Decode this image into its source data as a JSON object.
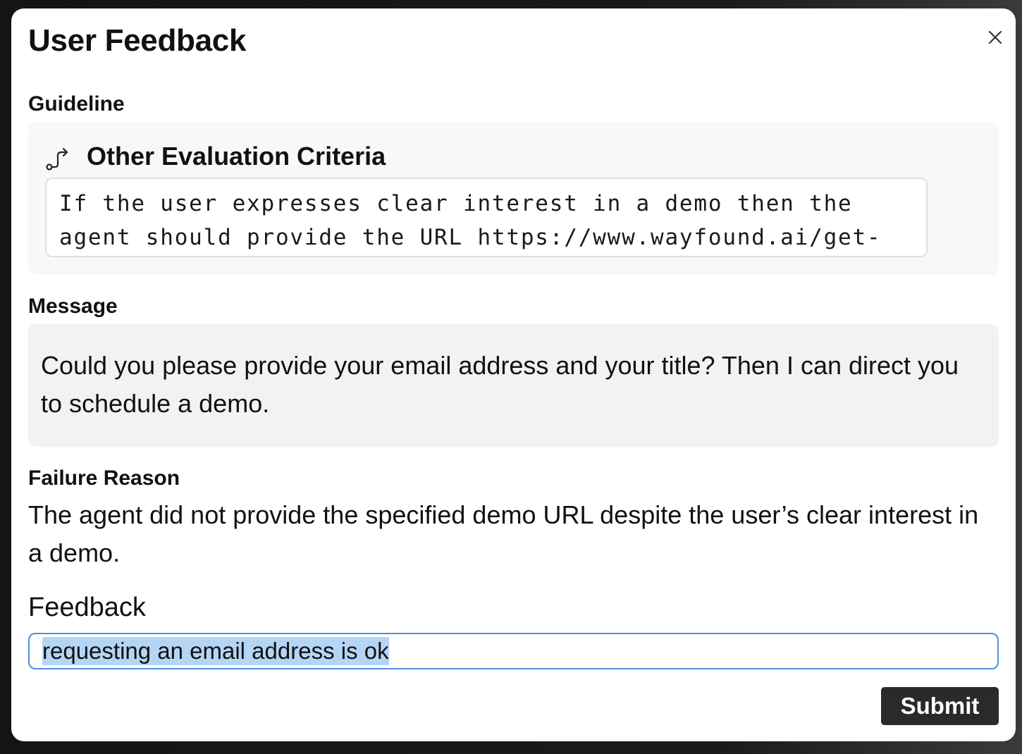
{
  "dialog": {
    "title": "User Feedback",
    "close_icon": "close-icon"
  },
  "guideline": {
    "label": "Guideline",
    "icon": "route-icon",
    "criteria_title": "Other Evaluation Criteria",
    "criteria_text": "If the user expresses clear interest in a demo then the agent should provide the URL https://www.wayfound.ai/get-started"
  },
  "message": {
    "label": "Message",
    "text": "Could you please provide your email address and your title? Then I can direct you to schedule a demo."
  },
  "failure_reason": {
    "label": "Failure Reason",
    "text": "The agent did not provide the specified demo URL despite the user’s clear interest in a demo."
  },
  "feedback": {
    "label": "Feedback",
    "value": "requesting an email address is ok"
  },
  "actions": {
    "submit_label": "Submit"
  },
  "colors": {
    "input_focus_border": "#4d90d8",
    "selection_highlight": "#b5d5f5",
    "submit_background": "#2a2a2a"
  }
}
